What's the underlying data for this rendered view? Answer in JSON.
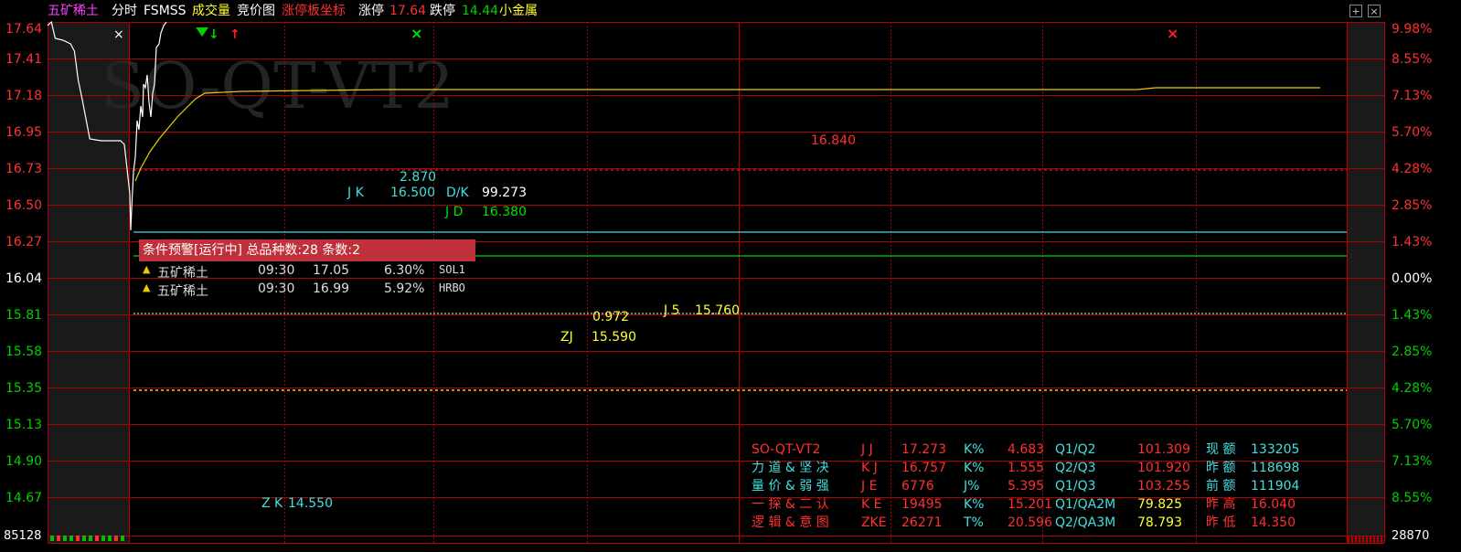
{
  "header": {
    "stock_name": "五矿稀土",
    "tab_intraday": "分时",
    "indicator": "FSMSS",
    "tab_volume": "成交量",
    "tab_auction": "竞价图",
    "tab_limit_axis": "涨停板坐标",
    "limit_up_label": "涨停",
    "limit_up_value": "17.64",
    "limit_down_label": "跌停",
    "limit_down_value": "14.44",
    "sector": "小金属",
    "btn_add": "+",
    "btn_close": "×"
  },
  "colors": {
    "name": "#ff40ff",
    "up": "#ff3030",
    "down": "#00d000",
    "grid": "#b00000",
    "yellow": "#ffff30",
    "cyan": "#40e0e0",
    "alert": "#c0303b"
  },
  "chart": {
    "watermark": "SO-QT-VT2",
    "left_axis": [
      "17.64",
      "17.41",
      "17.18",
      "16.95",
      "16.73",
      "16.50",
      "16.27",
      "16.04",
      "15.81",
      "15.58",
      "15.35",
      "15.13",
      "14.90",
      "14.67"
    ],
    "right_axis": [
      "9.98%",
      "8.55%",
      "7.13%",
      "5.70%",
      "4.28%",
      "2.85%",
      "1.43%",
      "0.00%",
      "1.43%",
      "2.85%",
      "4.28%",
      "5.70%",
      "7.13%",
      "8.55%"
    ],
    "volume_left": "85128",
    "volume_right": "28870",
    "price_line": [
      [
        0,
        17.62
      ],
      [
        2,
        17.64
      ],
      [
        4,
        17.55
      ],
      [
        8,
        17.54
      ],
      [
        12,
        17.52
      ],
      [
        14,
        17.48
      ],
      [
        16,
        17.32
      ],
      [
        18,
        17.22
      ],
      [
        22,
        17.0
      ],
      [
        28,
        16.99
      ],
      [
        34,
        16.99
      ],
      [
        38,
        16.99
      ],
      [
        40,
        16.97
      ],
      [
        42,
        16.7
      ],
      [
        43,
        16.5
      ],
      [
        44,
        16.62
      ],
      [
        46,
        16.82
      ],
      [
        48,
        16.9
      ],
      [
        50,
        17.1
      ],
      [
        52,
        17.05
      ],
      [
        54,
        17.18
      ],
      [
        56,
        17.12
      ],
      [
        57,
        17.3
      ],
      [
        59,
        17.28
      ],
      [
        61,
        17.35
      ],
      [
        63,
        17.2
      ],
      [
        65,
        17.12
      ],
      [
        67,
        17.25
      ],
      [
        69,
        17.3
      ],
      [
        71,
        17.5
      ],
      [
        74,
        17.52
      ],
      [
        76,
        17.58
      ],
      [
        79,
        17.62
      ],
      [
        82,
        17.64
      ]
    ],
    "avg_line": [
      [
        44,
        16.77
      ],
      [
        50,
        16.84
      ],
      [
        60,
        16.93
      ],
      [
        70,
        17.0
      ],
      [
        80,
        17.06
      ],
      [
        90,
        17.12
      ],
      [
        100,
        17.17
      ],
      [
        110,
        17.22
      ],
      [
        120,
        17.25
      ],
      [
        160,
        17.26
      ],
      [
        320,
        17.27
      ],
      [
        1140,
        17.27
      ],
      [
        1160,
        17.28
      ],
      [
        1340,
        17.28
      ]
    ],
    "levels": {
      "jk": "16.500",
      "jd": "16.380",
      "zj": "15.590",
      "mid": "16.840",
      "j5": "15.760",
      "zk": "14.550"
    },
    "annotations": {
      "val_2870": "2.870",
      "jk_label": "J K",
      "jk_value": "16.500",
      "dk_label": "D/K",
      "dk_value": "99.273",
      "jd_label": "J D",
      "jd_value": "16.380",
      "mid_value": "16.840",
      "val_0972": "0.972",
      "j5_label": "J 5",
      "j5_value": "15.760",
      "zj_label": "ZJ",
      "zj_value": "15.590",
      "zk_label": "Z K",
      "zk_value": "14.550"
    },
    "markers": {
      "x_white": "×",
      "x_green": "×",
      "x_red": "×",
      "arrow_up": "↑",
      "arrow_down": "↓"
    }
  },
  "alert": {
    "title": "条件预警[运行中] 总品种数:28 条数:2",
    "rows": [
      {
        "name": "五矿稀土",
        "time": "09:30",
        "price": "17.05",
        "pct": "6.30%",
        "code": "SOL1"
      },
      {
        "name": "五矿稀土",
        "time": "09:30",
        "price": "16.99",
        "pct": "5.92%",
        "code": "HRBO"
      }
    ]
  },
  "table": [
    {
      "c1": "SO-QT-VT2",
      "c2": "J J",
      "c3": "17.273",
      "c4": "K%",
      "c5": "4.683",
      "c6": "Q1/Q2",
      "c7": "101.309",
      "c8": "现 额",
      "c9": "133205",
      "k1": "red",
      "k7": "red"
    },
    {
      "c1": "力 道 & 坚 决",
      "c2": "K J",
      "c3": "16.757",
      "c4": "K%",
      "c5": "1.555",
      "c6": "Q2/Q3",
      "c7": "101.920",
      "c8": "昨 额",
      "c9": "118698",
      "k1": "cyan",
      "k7": "red"
    },
    {
      "c1": "量 价 & 弱 强",
      "c2": "J E",
      "c3": "6776",
      "c4": "J%",
      "c5": "5.395",
      "c6": "Q1/Q3",
      "c7": "103.255",
      "c8": "前 额",
      "c9": "111904",
      "k1": "cyan",
      "k7": "red"
    },
    {
      "c1": "一 探 & 二 认",
      "c2": "K E",
      "c3": "19495",
      "c4": "K%",
      "c5": "15.201",
      "c6": "Q1/QA2M",
      "c7": "79.825",
      "c8": "昨 高",
      "c9": "16.040",
      "k1": "red",
      "k7": "yellow"
    },
    {
      "c1": "逻 辑 & 意 图",
      "c2": "ZKE",
      "c3": "26271",
      "c4": "T%",
      "c5": "20.596",
      "c6": "Q2/QA3M",
      "c7": "78.793",
      "c8": "昨 低",
      "c9": "14.350",
      "k1": "red",
      "k7": "yellow"
    }
  ]
}
